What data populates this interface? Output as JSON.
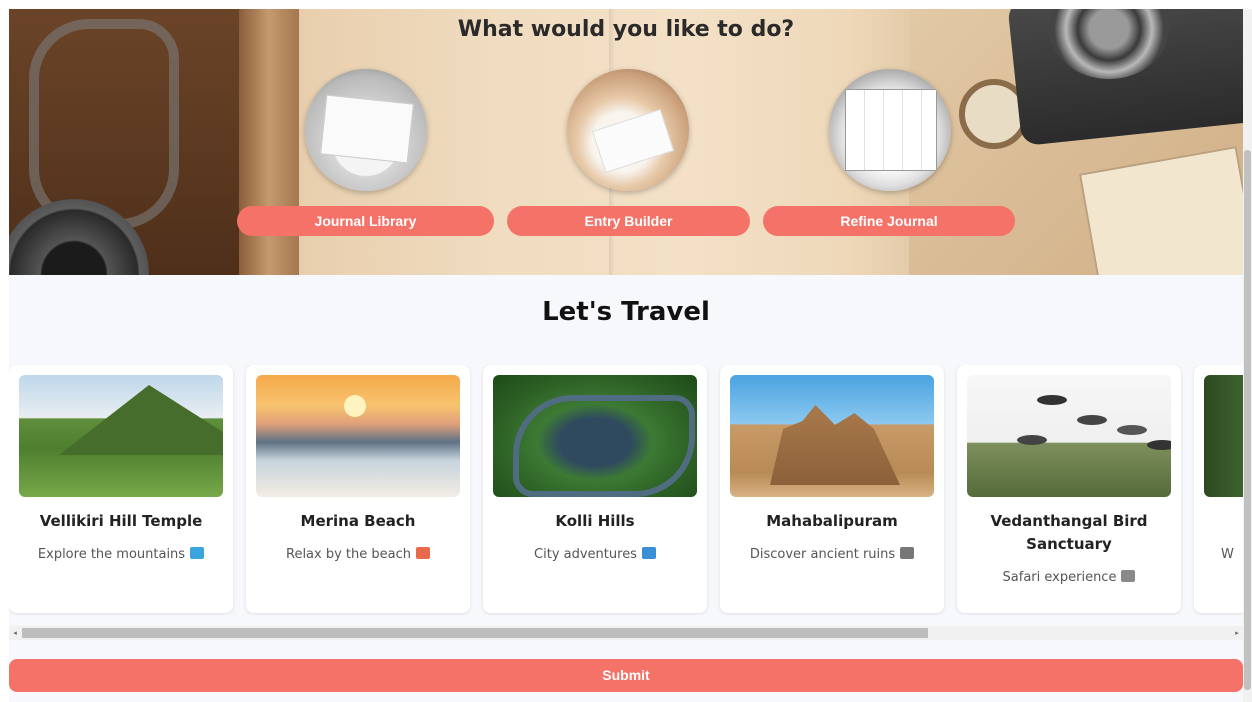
{
  "hero": {
    "title": "What would you like to do?",
    "options": [
      {
        "label": "Journal Library",
        "image": "journal-photo"
      },
      {
        "label": "Entry Builder",
        "image": "writing-photo"
      },
      {
        "label": "Refine Journal",
        "image": "planner-photo"
      }
    ]
  },
  "travel": {
    "title": "Let's Travel",
    "cards": [
      {
        "title": "Vellikiri Hill Temple",
        "subtitle": "Explore the mountains",
        "emoji_icon": "mountain-emoji",
        "emoji_color": "#3aa6dd"
      },
      {
        "title": "Merina Beach",
        "subtitle": "Relax by the beach",
        "emoji_icon": "beach-emoji",
        "emoji_color": "#e86a4a"
      },
      {
        "title": "Kolli Hills",
        "subtitle": "City adventures",
        "emoji_icon": "city-emoji",
        "emoji_color": "#3b8fd6"
      },
      {
        "title": "Mahabalipuram",
        "subtitle": "Discover ancient ruins",
        "emoji_icon": "ruins-emoji",
        "emoji_color": "#777777"
      },
      {
        "title": "Vedanthangal Bird Sanctuary",
        "subtitle": "Safari experience",
        "emoji_icon": "elephant-emoji",
        "emoji_color": "#8a8a8a"
      },
      {
        "title": "",
        "subtitle": "W",
        "emoji_icon": "",
        "emoji_color": ""
      }
    ]
  },
  "scrollbar": {
    "left_arrow": "◂",
    "right_arrow": "▸"
  },
  "submit_label": "Submit",
  "colors": {
    "accent": "#f47268",
    "section_bg": "#f7f8fb"
  }
}
